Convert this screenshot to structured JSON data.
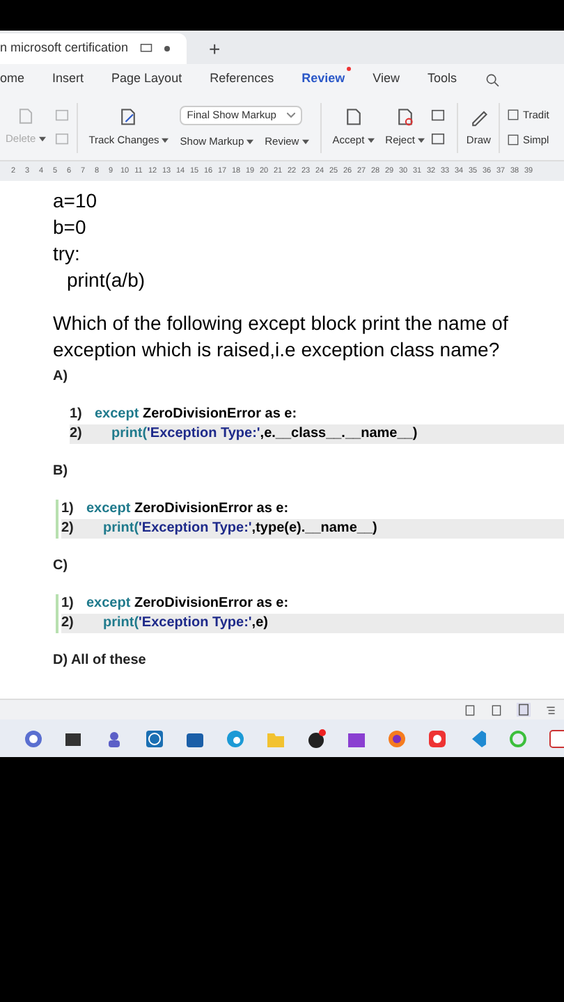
{
  "doc_tab": {
    "title": "n microsoft certification",
    "new_tab": "+"
  },
  "menu": [
    {
      "label": "ome",
      "selected": false
    },
    {
      "label": "Insert",
      "selected": false
    },
    {
      "label": "Page Layout",
      "selected": false
    },
    {
      "label": "References",
      "selected": false
    },
    {
      "label": "Review",
      "selected": true
    },
    {
      "label": "View",
      "selected": false
    },
    {
      "label": "Tools",
      "selected": false
    }
  ],
  "ribbon": {
    "delete": {
      "label": "Delete",
      "disabled": true
    },
    "track_changes": "Track Changes",
    "markup_select": "Final Show Markup",
    "show_markup": "Show Markup",
    "review": "Review",
    "accept": "Accept",
    "reject": "Reject",
    "draw": "Draw",
    "traditional": "Tradit",
    "simplified": "Simpl"
  },
  "ruler": [
    "2",
    "3",
    "4",
    "5",
    "6",
    "7",
    "8",
    "9",
    "10",
    "11",
    "12",
    "13",
    "14",
    "15",
    "16",
    "17",
    "18",
    "19",
    "20",
    "21",
    "22",
    "23",
    "24",
    "25",
    "26",
    "27",
    "28",
    "29",
    "30",
    "31",
    "32",
    "33",
    "34",
    "35",
    "36",
    "37",
    "38",
    "39"
  ],
  "code_lines": [
    "a=10",
    "b=0",
    "try:",
    "print(a/b)"
  ],
  "question": "Which of the following except block print the name of exception which is raised,i.e exception class name?",
  "options": [
    {
      "label": "A)",
      "bar": false,
      "lines": [
        {
          "num": "1)",
          "shaded": false,
          "segments": [
            {
              "kind": "keyword",
              "text": "except"
            },
            {
              "kind": "plain",
              "text": " ZeroDivisionError as e:"
            }
          ]
        },
        {
          "num": "2)",
          "shaded": true,
          "segments": [
            {
              "kind": "keyword",
              "text": "print("
            },
            {
              "kind": "string",
              "text": "'Exception Type:'"
            },
            {
              "kind": "plain",
              "text": ",e.__class__.__name__)"
            }
          ]
        }
      ]
    },
    {
      "label": "B)",
      "bar": true,
      "lines": [
        {
          "num": "1)",
          "shaded": false,
          "segments": [
            {
              "kind": "keyword",
              "text": "except"
            },
            {
              "kind": "plain",
              "text": " ZeroDivisionError as e:"
            }
          ]
        },
        {
          "num": "2)",
          "shaded": true,
          "segments": [
            {
              "kind": "keyword",
              "text": "print("
            },
            {
              "kind": "string",
              "text": "'Exception Type:'"
            },
            {
              "kind": "plain",
              "text": ",type(e).__name__)"
            }
          ]
        }
      ]
    },
    {
      "label": "C)",
      "bar": true,
      "lines": [
        {
          "num": "1)",
          "shaded": false,
          "segments": [
            {
              "kind": "keyword",
              "text": "except"
            },
            {
              "kind": "plain",
              "text": " ZeroDivisionError as e:"
            }
          ]
        },
        {
          "num": "2)",
          "shaded": true,
          "segments": [
            {
              "kind": "keyword",
              "text": "print("
            },
            {
              "kind": "string",
              "text": "'Exception Type:'"
            },
            {
              "kind": "plain",
              "text": ",e)"
            }
          ]
        }
      ]
    }
  ],
  "answer_d": "D) All of these"
}
